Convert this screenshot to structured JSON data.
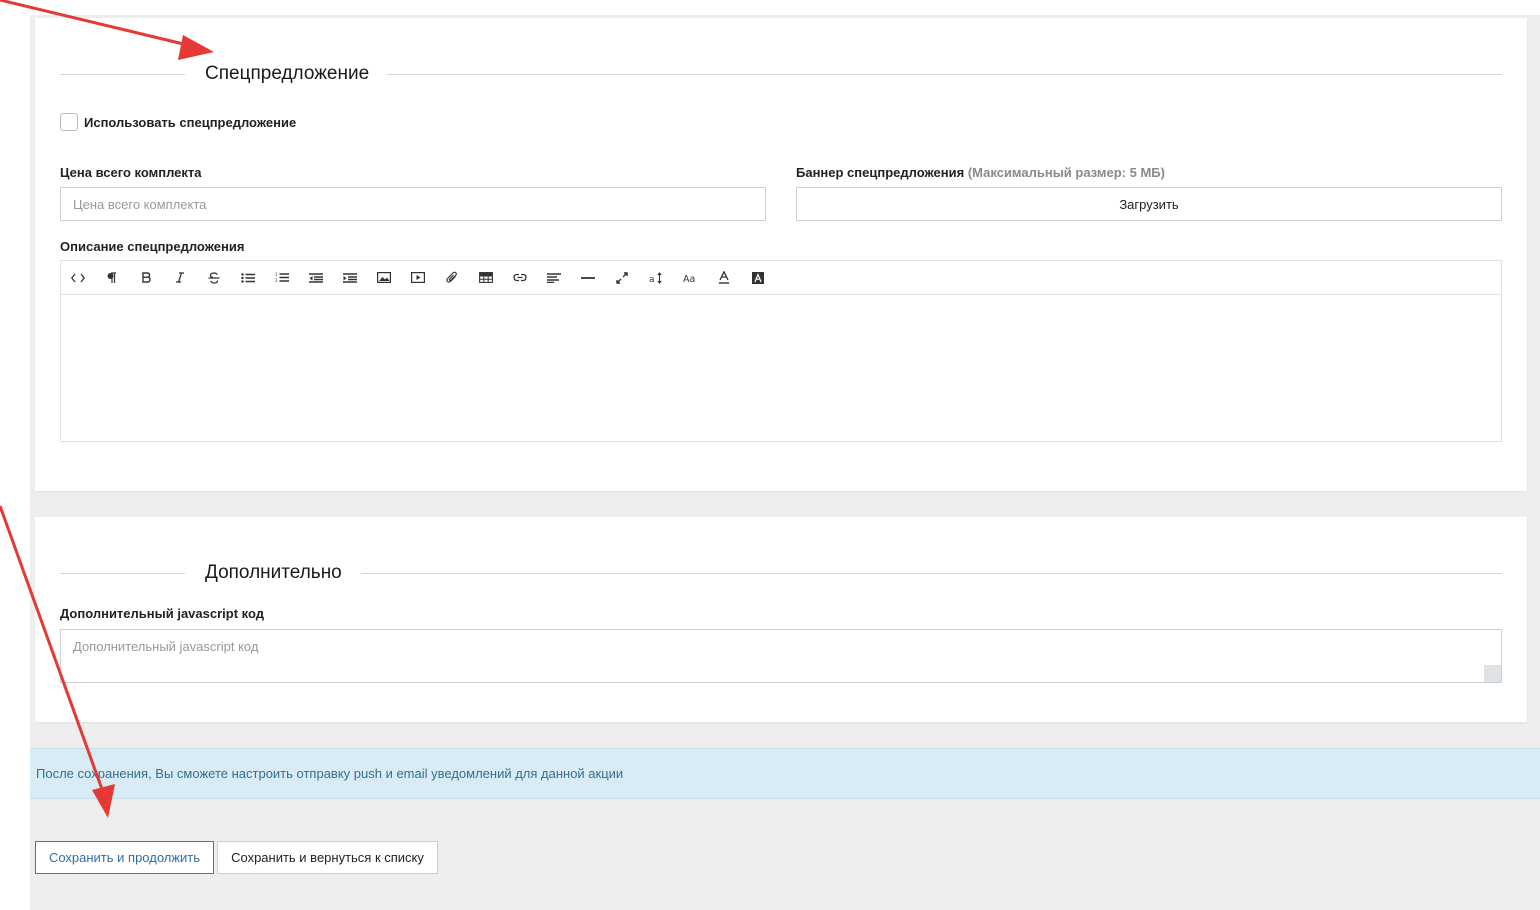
{
  "special_offer": {
    "section_title": "Спецпредложение",
    "use_checkbox_label": "Использовать спецпредложение",
    "use_checkbox_checked": false,
    "price_label": "Цена всего комплекта",
    "price_placeholder": "Цена всего комплекта",
    "price_value": "",
    "banner_label": "Баннер спецпредложения",
    "banner_hint": "(Максимальный размер: 5 МБ)",
    "upload_label": "Загрузить",
    "description_label": "Описание спецпредложения",
    "toolbar_icons": [
      "code-view-icon",
      "paragraph-icon",
      "bold-icon",
      "italic-icon",
      "strikethrough-icon",
      "bullet-list-icon",
      "numbered-list-icon",
      "outdent-icon",
      "indent-icon",
      "image-icon",
      "video-icon",
      "file-attach-icon",
      "table-icon",
      "link-icon",
      "align-left-icon",
      "horizontal-rule-icon",
      "fullscreen-icon",
      "font-size-icon",
      "font-family-icon",
      "text-color-icon",
      "background-color-icon"
    ]
  },
  "additional": {
    "section_title": "Дополнительно",
    "js_label": "Дополнительный javascript код",
    "js_placeholder": "Дополнительный javascript код"
  },
  "info_message": "После сохранения, Вы сможете настроить отправку push и email уведомлений для данной акции",
  "actions": {
    "save_continue": "Сохранить и продолжить",
    "save_return": "Сохранить и вернуться к списку"
  },
  "colors": {
    "annotation_arrow": "#e53935",
    "primary_button_border": "#3a7bbf",
    "info_background": "#d9ecf5",
    "info_text": "#31708f"
  }
}
